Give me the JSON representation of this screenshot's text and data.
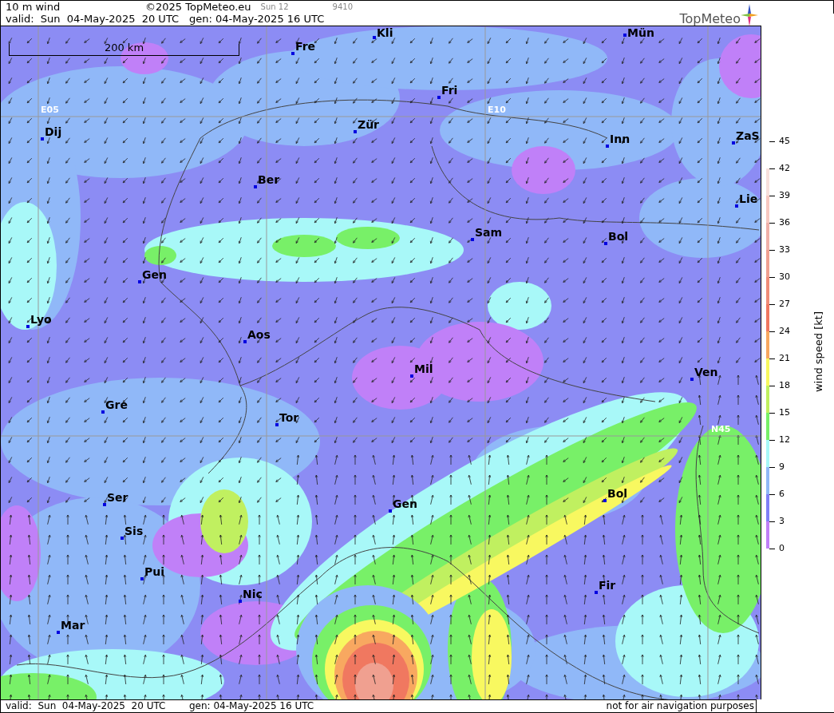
{
  "header": {
    "product": "10 m wind",
    "copyright": "©2025 TopMeteo.eu",
    "step": "Sun 12",
    "code": "9410",
    "valid": "valid:  Sun  04-May-2025  20 UTC",
    "generated": "gen: 04-May-2025 16 UTC",
    "logo": "TopMeteo"
  },
  "map": {
    "scale": "200 km",
    "grid_labels": [
      "E05",
      "E10",
      "N45"
    ],
    "cities": [
      "Kli",
      "Mün",
      "Fre",
      "Fri",
      "Dij",
      "Zür",
      "Inn",
      "ZaS",
      "Ber",
      "Lie",
      "Sam",
      "Bol",
      "Gen",
      "Lyo",
      "Aos",
      "Mil",
      "Ven",
      "Gre",
      "Tor",
      "Ser",
      "Gen",
      "Bol",
      "Sis",
      "Pui",
      "Nic",
      "Fir",
      "Mar"
    ]
  },
  "legend": {
    "title": "wind speed [kt]",
    "ticks": [
      "45",
      "42",
      "39",
      "36",
      "33",
      "30",
      "27",
      "24",
      "21",
      "18",
      "15",
      "12",
      "9",
      "6",
      "3",
      "0"
    ],
    "bands": [
      {
        "color": "#f8e0dc"
      },
      {
        "color": "#f8c8c0"
      },
      {
        "color": "#f0b0a8"
      },
      {
        "color": "#f0a090"
      },
      {
        "color": "#f08c78"
      },
      {
        "color": "#f07860"
      },
      {
        "color": "#f8a860"
      },
      {
        "color": "#f8f860"
      },
      {
        "color": "#c0f060"
      },
      {
        "color": "#78f068"
      },
      {
        "color": "#a8f8f8"
      },
      {
        "color": "#90b8f8"
      },
      {
        "color": "#8080f8"
      },
      {
        "color": "#c080f8"
      }
    ]
  },
  "footer": {
    "valid": "valid:  Sun  04-May-2025  20 UTC",
    "generated": "gen: 04-May-2025 16 UTC",
    "disclaimer": "not for air navigation purposes"
  }
}
